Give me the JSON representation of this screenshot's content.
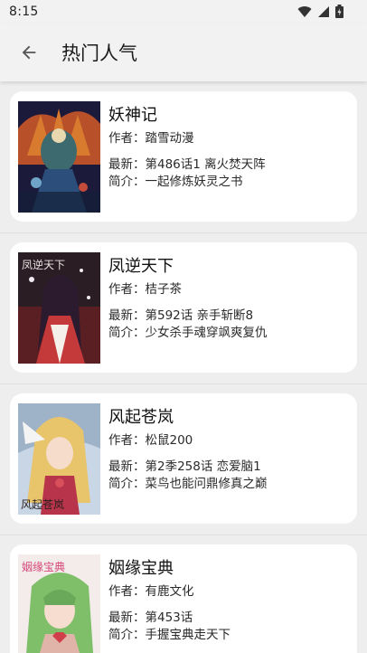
{
  "status_bar": {
    "time": "8:15"
  },
  "app_bar": {
    "title": "热门人气"
  },
  "labels": {
    "author": "作者：",
    "latest": "最新：",
    "intro": "简介："
  },
  "comics": [
    {
      "title": "妖神记",
      "author": "踏雪动漫",
      "latest": "第486话1 离火焚天阵",
      "intro": "一起修炼妖灵之书"
    },
    {
      "title": "凤逆天下",
      "author": "桔子茶",
      "latest": "第592话 亲手斩断8",
      "intro": "少女杀手魂穿飒爽复仇",
      "cover_text": "凤逆天下"
    },
    {
      "title": "风起苍岚",
      "author": "松鼠200",
      "latest": "第2季258话 恋爱脑1",
      "intro": "菜鸟也能问鼎修真之巅",
      "cover_text": "风起苍岚"
    },
    {
      "title": "姻缘宝典",
      "author": "有鹿文化",
      "latest": "第453话",
      "intro": "手握宝典走天下",
      "cover_text": "姻缘宝典"
    }
  ]
}
